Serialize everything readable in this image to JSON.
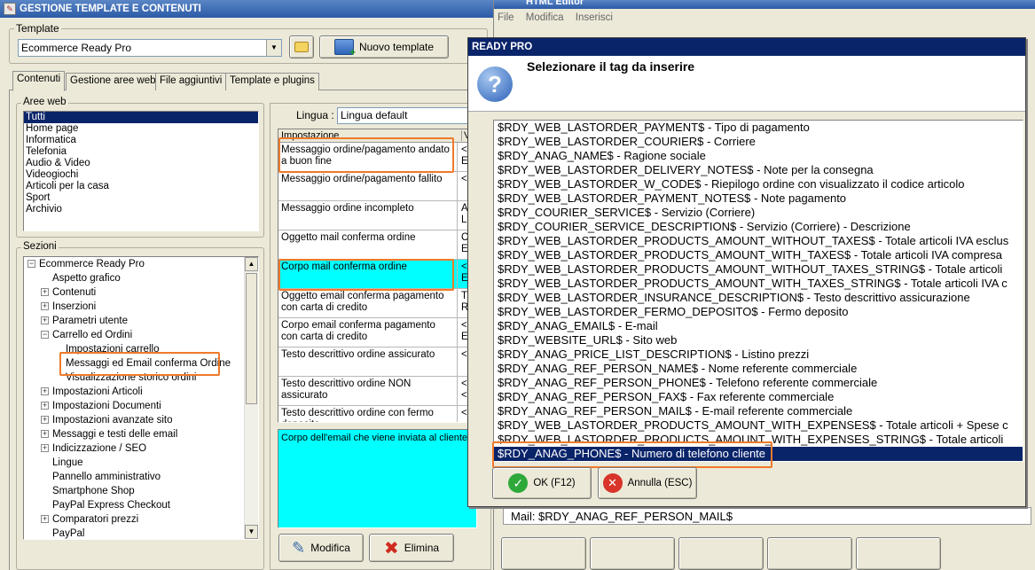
{
  "main_window": {
    "title": "GESTIONE TEMPLATE E CONTENUTI",
    "template_group_label": "Template",
    "template_selected": "Ecommerce Ready Pro",
    "new_template_label": "Nuovo template",
    "tabs": [
      {
        "label": "Contenuti"
      },
      {
        "label": "Gestione aree web"
      },
      {
        "label": "File aggiuntivi"
      },
      {
        "label": "Template e plugins"
      }
    ],
    "aree_web_label": "Aree web",
    "aree_web": [
      "Tutti",
      "Home page",
      "Informatica",
      "Telefonia",
      "Audio & Video",
      "Videogiochi",
      "Articoli per la casa",
      "Sport",
      "Archivio"
    ],
    "sezioni_label": "Sezioni",
    "tree": [
      {
        "label": "Ecommerce Ready Pro",
        "level": 0,
        "exp": "−"
      },
      {
        "label": "Aspetto grafico",
        "level": 1,
        "exp": ""
      },
      {
        "label": "Contenuti",
        "level": 1,
        "exp": "+"
      },
      {
        "label": "Inserzioni",
        "level": 1,
        "exp": "+"
      },
      {
        "label": "Parametri utente",
        "level": 1,
        "exp": "+"
      },
      {
        "label": "Carrello ed Ordini",
        "level": 1,
        "exp": "−"
      },
      {
        "label": "Impostazioni carrello",
        "level": 2,
        "exp": ""
      },
      {
        "label": "Messaggi ed Email conferma Ordine",
        "level": 2,
        "exp": ""
      },
      {
        "label": "Visualizzazione storico ordini",
        "level": 2,
        "exp": ""
      },
      {
        "label": "Impostazioni Articoli",
        "level": 1,
        "exp": "+"
      },
      {
        "label": "Impostazioni Documenti",
        "level": 1,
        "exp": "+"
      },
      {
        "label": "Impostazioni avanzate sito",
        "level": 1,
        "exp": "+"
      },
      {
        "label": "Messaggi e testi delle email",
        "level": 1,
        "exp": "+"
      },
      {
        "label": "Indicizzazione / SEO",
        "level": 1,
        "exp": "+"
      },
      {
        "label": "Lingue",
        "level": 1,
        "exp": ""
      },
      {
        "label": "Pannello amministrativo",
        "level": 1,
        "exp": ""
      },
      {
        "label": "Smartphone Shop",
        "level": 1,
        "exp": ""
      },
      {
        "label": "PayPal Express Checkout",
        "level": 1,
        "exp": ""
      },
      {
        "label": "Comparatori prezzi",
        "level": 1,
        "exp": "+"
      },
      {
        "label": "PayPal",
        "level": 1,
        "exp": ""
      }
    ],
    "lingua_label": "Lingua :",
    "lingua_value": "Lingua default",
    "grid_header_col1": "Impostazione",
    "grid_header_col2": "Va",
    "grid_rows": [
      {
        "name": "Messaggio ordine/pagamento andato a buon fine",
        "value": "<p\nE'",
        "h": 33
      },
      {
        "name": "Messaggio ordine/pagamento fallito",
        "value": "<p\n  <",
        "h": 33
      },
      {
        "name": "Messaggio ordine incompleto",
        "value": "Al\nL'",
        "h": 33
      },
      {
        "name": "Oggetto mail conferma ordine",
        "value": "CO\nE-",
        "h": 33
      },
      {
        "name": "Corpo mail conferma ordine",
        "value": "<p\nE'",
        "h": 33
      },
      {
        "name": "Oggetto email conferma pagamento con carta di credito",
        "value": "Tr\nRe",
        "h": 33
      },
      {
        "name": "Corpo email conferma pagamento con carta di credito",
        "value": "<p\nE'",
        "h": 33
      },
      {
        "name": "Testo descrittivo ordine assicurato",
        "value": "<s",
        "h": 33
      },
      {
        "name": "Testo descrittivo ordine NON assicurato",
        "value": "<s\n<s",
        "h": 33
      },
      {
        "name": "Testo descrittivo ordine con fermo deposito",
        "value": "<s",
        "h": 20
      }
    ],
    "description_text": "Corpo dell'email che viene inviata al cliente d",
    "modifica_label": "Modifica",
    "elimina_label": "Elimina"
  },
  "html_editor": {
    "title": "HTML Editor",
    "menu": [
      "File",
      "Modifica",
      "Inserisci"
    ],
    "bottom_text": "Mail: $RDY_ANAG_REF_PERSON_MAIL$"
  },
  "dialog": {
    "title": "READY PRO",
    "heading": "Selezionare il tag da inserire",
    "items": [
      "$RDY_WEB_LASTORDER_PAYMENT$ - Tipo di pagamento",
      "$RDY_WEB_LASTORDER_COURIER$ - Corriere",
      "$RDY_ANAG_NAME$ - Ragione sociale",
      "$RDY_WEB_LASTORDER_DELIVERY_NOTES$ - Note per la consegna",
      "$RDY_WEB_LASTORDER_W_CODE$ - Riepilogo ordine con visualizzato il codice articolo",
      "$RDY_WEB_LASTORDER_PAYMENT_NOTES$ - Note pagamento",
      "$RDY_COURIER_SERVICE$ - Servizio (Corriere)",
      "$RDY_COURIER_SERVICE_DESCRIPTION$ - Servizio (Corriere) - Descrizione",
      "$RDY_WEB_LASTORDER_PRODUCTS_AMOUNT_WITHOUT_TAXES$ - Totale articoli IVA esclus",
      "$RDY_WEB_LASTORDER_PRODUCTS_AMOUNT_WITH_TAXES$ - Totale articoli IVA compresa",
      "$RDY_WEB_LASTORDER_PRODUCTS_AMOUNT_WITHOUT_TAXES_STRING$ - Totale articoli",
      "$RDY_WEB_LASTORDER_PRODUCTS_AMOUNT_WITH_TAXES_STRING$ - Totale articoli IVA c",
      "$RDY_WEB_LASTORDER_INSURANCE_DESCRIPTION$ - Testo descrittivo assicurazione",
      "$RDY_WEB_LASTORDER_FERMO_DEPOSITO$ - Fermo deposito",
      "$RDY_ANAG_EMAIL$ - E-mail",
      "$RDY_WEBSITE_URL$ - Sito web",
      "$RDY_ANAG_PRICE_LIST_DESCRIPTION$ - Listino prezzi",
      "$RDY_ANAG_REF_PERSON_NAME$ - Nome referente commerciale",
      "$RDY_ANAG_REF_PERSON_PHONE$ - Telefono referente commerciale",
      "$RDY_ANAG_REF_PERSON_FAX$ - Fax referente commerciale",
      "$RDY_ANAG_REF_PERSON_MAIL$ - E-mail referente commerciale",
      "$RDY_WEB_LASTORDER_PRODUCTS_AMOUNT_WITH_EXPENSES$ - Totale articoli + Spese c",
      "$RDY_WEB_LASTORDER_PRODUCTS_AMOUNT_WITH_EXPENSES_STRING$ - Totale articoli",
      "$RDY_ANAG_PHONE$ - Numero di telefono cliente"
    ],
    "selected_index": 23,
    "ok_label": "OK (F12)",
    "cancel_label": "Annulla (ESC)"
  },
  "colors": {
    "selection": "#0a246a",
    "dialog_title": "#0a246a",
    "highlight": "#ef7a2a",
    "cyan": "#00ffff",
    "window_bg": "#ece9d8"
  }
}
